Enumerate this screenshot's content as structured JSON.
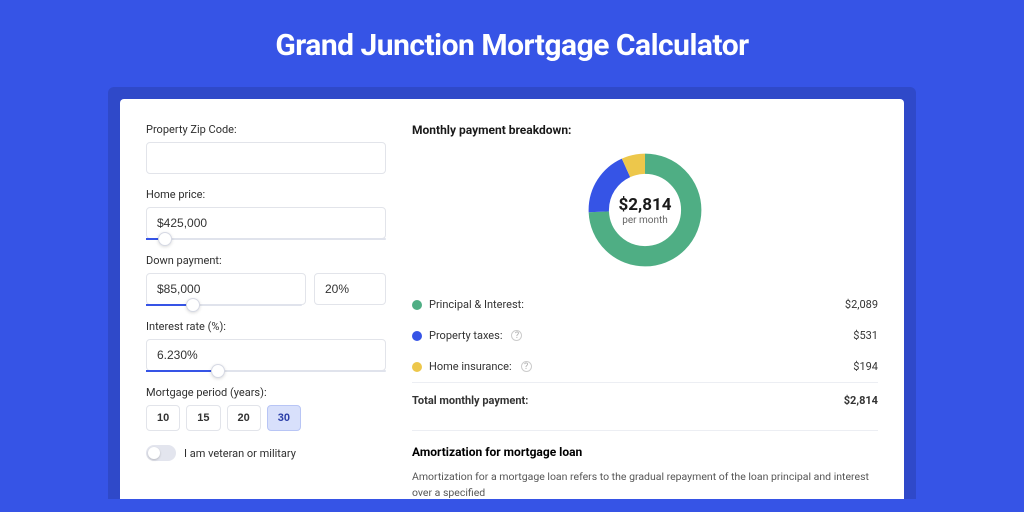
{
  "title": "Grand Junction Mortgage Calculator",
  "form": {
    "zip_label": "Property Zip Code:",
    "zip_value": "",
    "home_price_label": "Home price:",
    "home_price_value": "$425,000",
    "home_price_slider_pct": 8,
    "down_payment_label": "Down payment:",
    "down_payment_value": "$85,000",
    "down_payment_pct_value": "20%",
    "down_payment_slider_pct": 20,
    "interest_label": "Interest rate (%):",
    "interest_value": "6.230%",
    "interest_slider_pct": 30,
    "period_label": "Mortgage period (years):",
    "periods": [
      "10",
      "15",
      "20",
      "30"
    ],
    "period_active": "30",
    "veteran_label": "I am veteran or military"
  },
  "breakdown": {
    "title": "Monthly payment breakdown:",
    "total_display": "$2,814",
    "total_sub": "per month",
    "items": [
      {
        "label": "Principal & Interest:",
        "value": "$2,089",
        "color": "green",
        "has_info": false
      },
      {
        "label": "Property taxes:",
        "value": "$531",
        "color": "blue",
        "has_info": true
      },
      {
        "label": "Home insurance:",
        "value": "$194",
        "color": "yellow",
        "has_info": true
      }
    ],
    "total_label": "Total monthly payment:",
    "total_value": "$2,814"
  },
  "chart_data": {
    "type": "pie",
    "title": "Monthly payment breakdown",
    "series": [
      {
        "name": "Principal & Interest",
        "value": 2089,
        "color": "#4fae84"
      },
      {
        "name": "Property taxes",
        "value": 531,
        "color": "#3654e6"
      },
      {
        "name": "Home insurance",
        "value": 194,
        "color": "#edc74b"
      }
    ],
    "total": 2814
  },
  "amortization": {
    "title": "Amortization for mortgage loan",
    "text": "Amortization for a mortgage loan refers to the gradual repayment of the loan principal and interest over a specified"
  }
}
